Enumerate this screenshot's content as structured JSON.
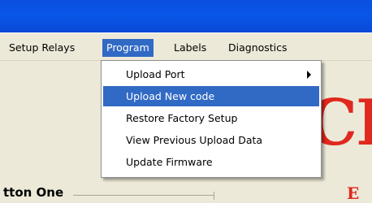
{
  "menubar": {
    "items": [
      {
        "label": "Setup Relays"
      },
      {
        "label": "Program"
      },
      {
        "label": "Labels"
      },
      {
        "label": "Diagnostics"
      }
    ]
  },
  "program_menu": {
    "items": [
      {
        "label": "Upload Port",
        "has_submenu": true
      },
      {
        "label": "Upload New code",
        "highlighted": true
      },
      {
        "label": "Restore Factory Setup"
      },
      {
        "label": "View Previous Upload Data"
      },
      {
        "label": "Update Firmware"
      }
    ]
  },
  "background": {
    "button_label": "tton One",
    "logo_text": "CI",
    "logo_small_text": "E"
  },
  "colors": {
    "titlebar": "#0856e8",
    "highlight": "#316ac5",
    "logo_red": "#e0281e",
    "window_bg": "#ece9d8"
  },
  "icons": {
    "submenu_arrow": "chevron-right-icon"
  }
}
